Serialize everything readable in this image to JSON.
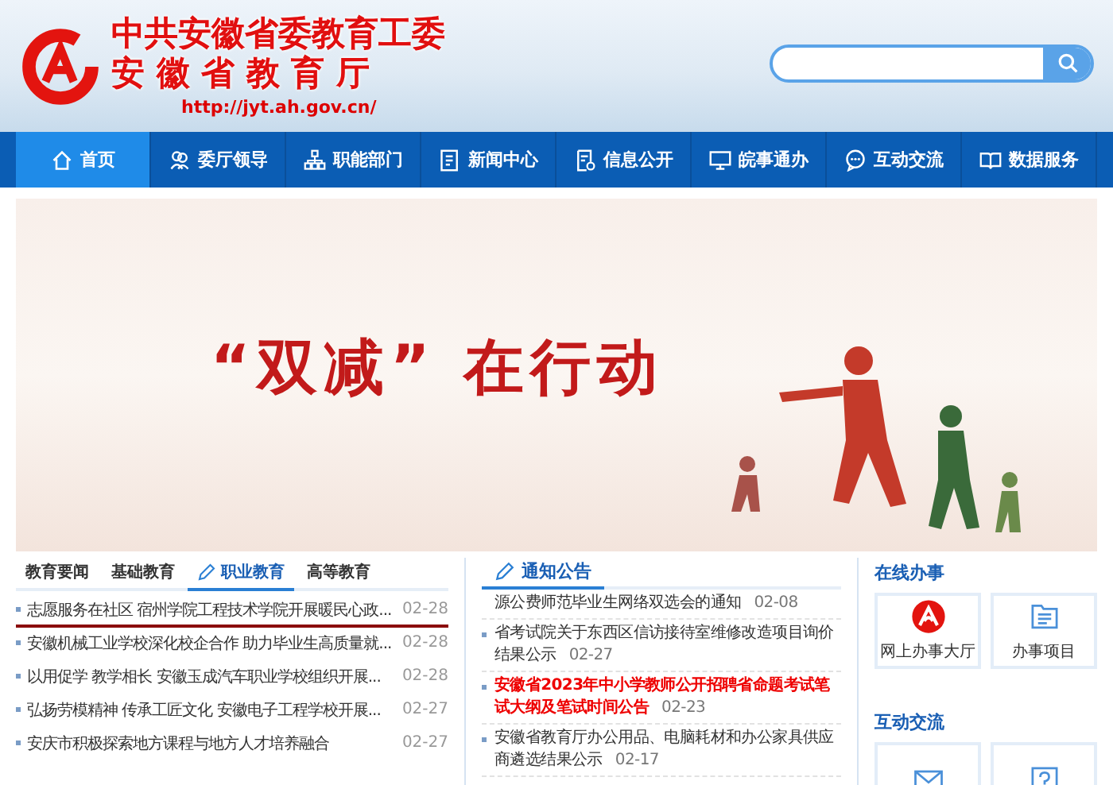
{
  "header": {
    "title_line1": "中共安徽省委教育工委",
    "title_line2": "安 徽 省 教 育 厅",
    "url": "http://jyt.ah.gov.cn/"
  },
  "nav": [
    {
      "label": "首页",
      "selected": true
    },
    {
      "label": "委厅领导",
      "selected": false
    },
    {
      "label": "职能部门",
      "selected": false
    },
    {
      "label": "新闻中心",
      "selected": false
    },
    {
      "label": "信息公开",
      "selected": false
    },
    {
      "label": "皖事通办",
      "selected": false
    },
    {
      "label": "互动交流",
      "selected": false
    },
    {
      "label": "数据服务",
      "selected": false
    }
  ],
  "banner": {
    "headline": "“双减” 在行动"
  },
  "news": {
    "tabs": [
      {
        "label": "教育要闻",
        "selected": false
      },
      {
        "label": "基础教育",
        "selected": false
      },
      {
        "label": "职业教育",
        "selected": true
      },
      {
        "label": "高等教育",
        "selected": false
      }
    ],
    "items": [
      {
        "title": "志愿服务在社区 宿州学院工程技术学院开展暖民心政...",
        "date": "02-28",
        "selected": true
      },
      {
        "title": "安徽机械工业学校深化校企合作 助力毕业生高质量就...",
        "date": "02-28",
        "selected": false
      },
      {
        "title": "以用促学 教学相长 安徽玉成汽车职业学校组织开展...",
        "date": "02-28",
        "selected": false
      },
      {
        "title": "弘扬劳模精神 传承工匠文化 安徽电子工程学校开展...",
        "date": "02-27",
        "selected": false
      },
      {
        "title": "安庆市积极探索地方课程与地方人才培养融合",
        "date": "02-27",
        "selected": false
      }
    ]
  },
  "notices": {
    "title": "通知公告",
    "items": [
      {
        "title": "源公费师范毕业生网络双选会的通知",
        "date": "02-08",
        "urgent": false,
        "bullet": false
      },
      {
        "title": "省考试院关于东西区信访接待室维修改造项目询价结果公示",
        "date": "02-27",
        "urgent": false,
        "bullet": true
      },
      {
        "title": "安徽省2023年中小学教师公开招聘省命题考试笔试大纲及笔试时间公告",
        "date": "02-23",
        "urgent": true,
        "bullet": true
      },
      {
        "title": "安徽省教育厅办公用品、电脑耗材和办公家具供应商遴选结果公示",
        "date": "02-17",
        "urgent": false,
        "bullet": true
      }
    ]
  },
  "services": [
    {
      "title": "在线办事",
      "tiles": [
        {
          "kind": "hall",
          "label": "网上办事大厅"
        },
        {
          "kind": "folder",
          "label": "办事项目"
        }
      ]
    },
    {
      "title": "互动交流",
      "tiles": [
        {
          "kind": "mail"
        },
        {
          "kind": "help"
        }
      ]
    }
  ]
}
